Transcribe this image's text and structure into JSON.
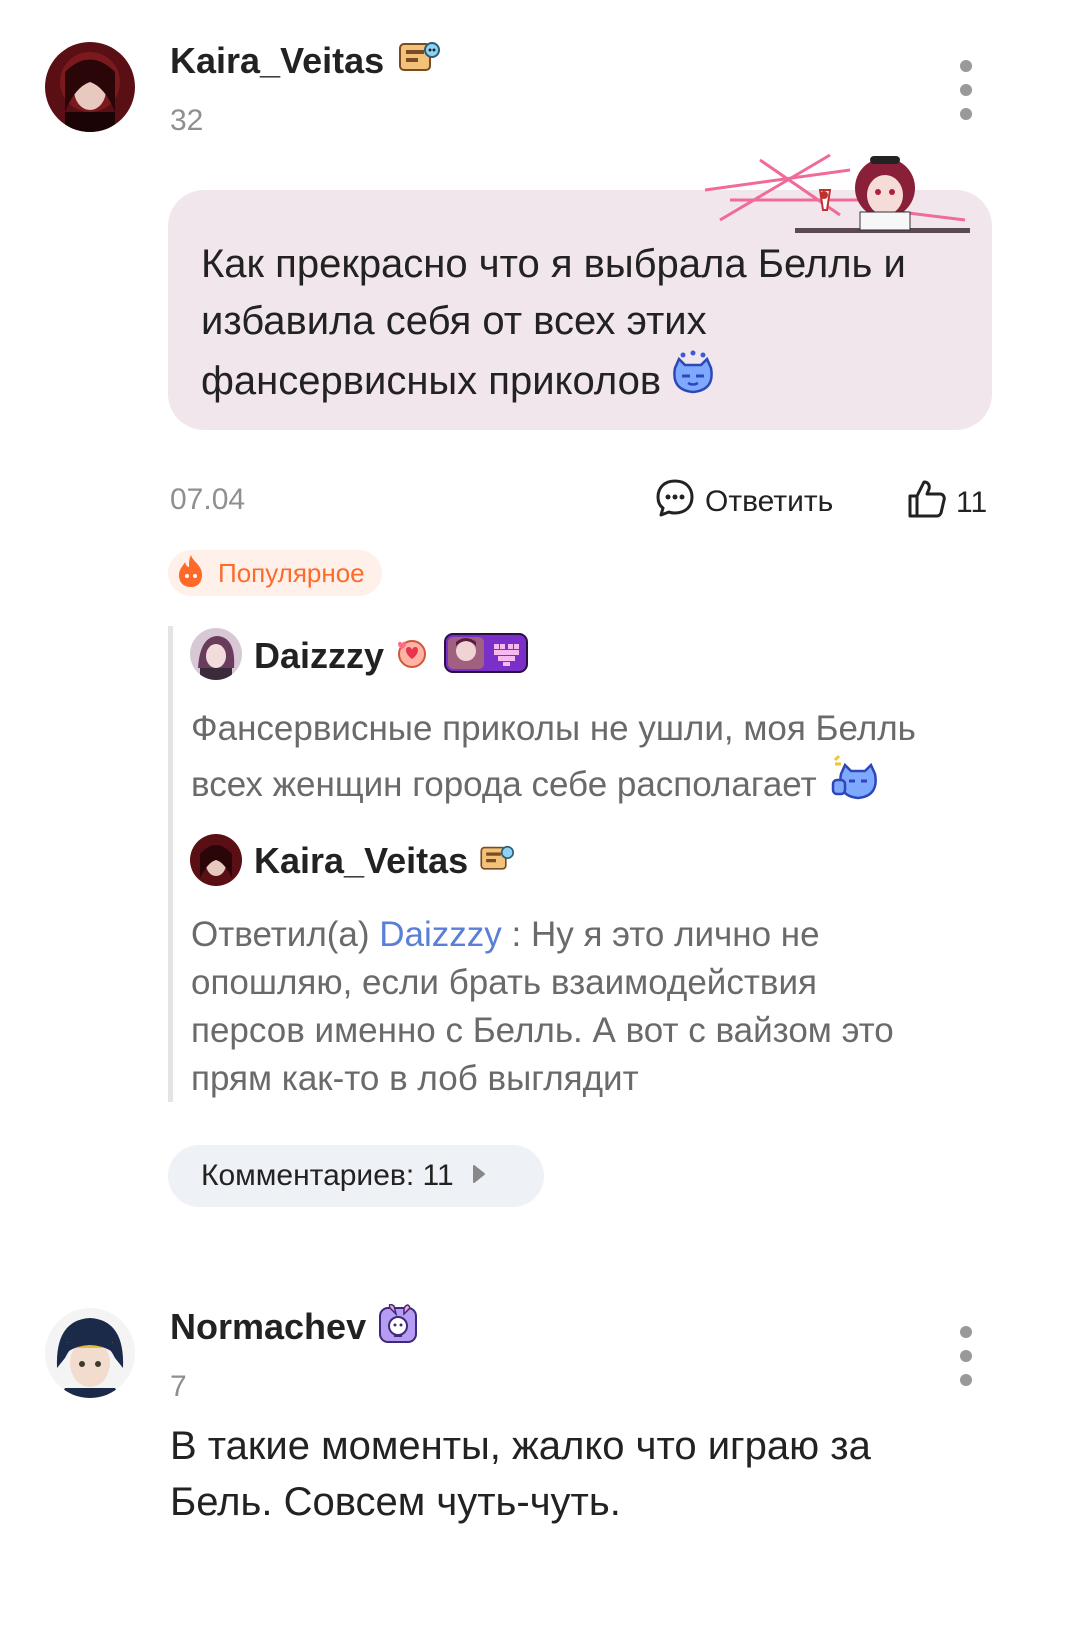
{
  "comment1": {
    "username": "Kaira_Veitas",
    "level": "32",
    "text_line1": "Как прекрасно что я выбрала Белль и",
    "text_line2": "избавила себя от всех этих",
    "text_line3": "фансервисных приколов",
    "date": "07.04",
    "reply_label": "Ответить",
    "likes": "11",
    "badge": "Популярное"
  },
  "replies": [
    {
      "username": "Daizzzy",
      "text_line1": "Фансервисные приколы не ушли, моя Белль",
      "text_line2": "всех женщин города себе располагает"
    },
    {
      "username": "Kaira_Veitas",
      "prefix": "Ответил(а)",
      "mention": "Daizzzy",
      "text_line1_rest": " : Ну я это лично не",
      "text_line2": "опошляю, если брать взаимодействия",
      "text_line3": "персов именно с Белль. А вот с вайзом это",
      "text_line4": "прям как-то в лоб выглядит"
    }
  ],
  "more_comments": "Комментариев: 11",
  "comment2": {
    "username": "Normachev",
    "level": "7",
    "text_line1": "В такие моменты, жалко что играю за",
    "text_line2": "Бель. Совсем чуть-чуть."
  },
  "colors": {
    "bubble": "#f1e6ec",
    "accent_orange": "#ff6a2b",
    "mention_blue": "#5a7fd6"
  }
}
